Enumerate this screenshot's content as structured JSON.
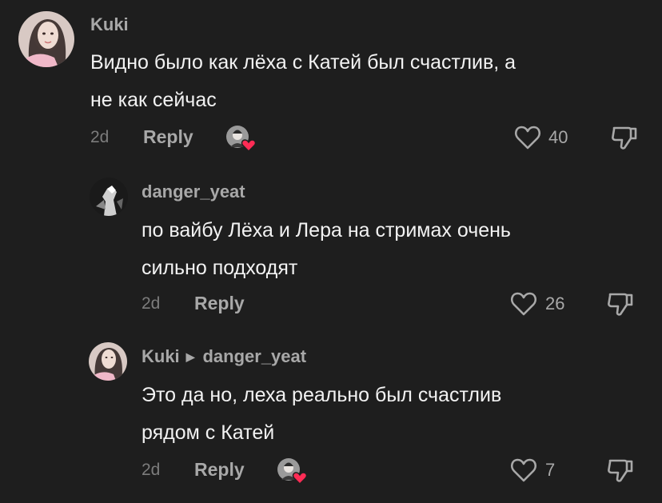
{
  "comments": [
    {
      "author": "Kuki",
      "reply_to": "",
      "text_line1": "Видно было как лёха с Катей был счастлив, а",
      "text_line2": "не как сейчас",
      "time": "2d",
      "reply_label": "Reply",
      "likes": "40"
    },
    {
      "author": "danger_yeat",
      "reply_to": "",
      "text_line1": "по вайбу Лёха и Лера на стримах очень",
      "text_line2": "сильно подходят",
      "time": "2d",
      "reply_label": "Reply",
      "likes": "26"
    },
    {
      "author": "Kuki",
      "reply_to": "danger_yeat",
      "text_line1": "Это да но, леха реально был счастлив",
      "text_line2": "рядом с Катей",
      "time": "2d",
      "reply_label": "Reply",
      "likes": "7"
    }
  ],
  "colors": {
    "background": "#1e1e1e",
    "muted_text": "#a8a8a8",
    "heart_badge": "#fe2c55"
  },
  "icons": {
    "like": "heart-outline-icon",
    "dislike": "thumbs-down-icon",
    "creator_liked": "creator-liked-heart-icon"
  }
}
